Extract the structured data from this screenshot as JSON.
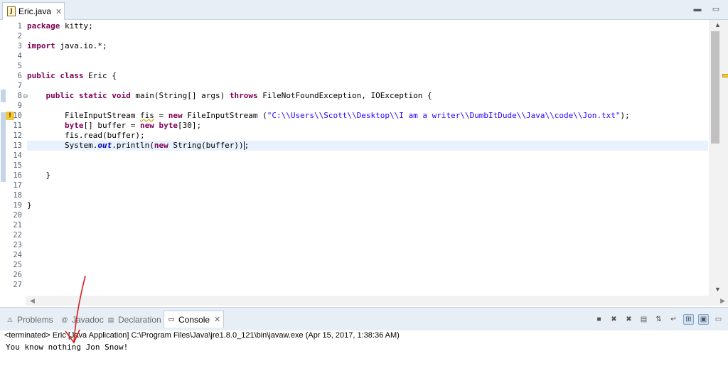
{
  "editor": {
    "tab_label": "Eric.java",
    "tab_icon": "J",
    "lines": [
      {
        "n": "1",
        "segs": [
          {
            "t": "package",
            "c": "kw"
          },
          {
            "t": " kitty;"
          }
        ]
      },
      {
        "n": "2",
        "segs": []
      },
      {
        "n": "3",
        "segs": [
          {
            "t": "import",
            "c": "kw"
          },
          {
            "t": " java.io.*;"
          }
        ]
      },
      {
        "n": "4",
        "segs": []
      },
      {
        "n": "5",
        "segs": []
      },
      {
        "n": "6",
        "segs": [
          {
            "t": "public",
            "c": "kw"
          },
          {
            "t": " "
          },
          {
            "t": "class",
            "c": "kw"
          },
          {
            "t": " Eric {"
          }
        ]
      },
      {
        "n": "7",
        "segs": []
      },
      {
        "n": "8",
        "segs": [
          {
            "t": "    "
          },
          {
            "t": "public",
            "c": "kw"
          },
          {
            "t": " "
          },
          {
            "t": "static",
            "c": "kw"
          },
          {
            "t": " "
          },
          {
            "t": "void",
            "c": "kw"
          },
          {
            "t": " main(String[] args) "
          },
          {
            "t": "throws",
            "c": "kw"
          },
          {
            "t": " FileNotFoundException, IOException {"
          }
        ]
      },
      {
        "n": "9",
        "segs": []
      },
      {
        "n": "10",
        "segs": [
          {
            "t": "        FileInputStream "
          },
          {
            "t": "fis",
            "c": "warnvar"
          },
          {
            "t": " = "
          },
          {
            "t": "new",
            "c": "kw"
          },
          {
            "t": " FileInputStream ("
          },
          {
            "t": "\"C:\\\\Users\\\\Scott\\\\Desktop\\\\I am a writer\\\\DumbItDude\\\\Java\\\\code\\\\Jon.txt\"",
            "c": "str"
          },
          {
            "t": ");"
          }
        ]
      },
      {
        "n": "11",
        "segs": [
          {
            "t": "        "
          },
          {
            "t": "byte",
            "c": "kw"
          },
          {
            "t": "[] buffer = "
          },
          {
            "t": "new",
            "c": "kw"
          },
          {
            "t": " "
          },
          {
            "t": "byte",
            "c": "kw"
          },
          {
            "t": "[30];"
          }
        ]
      },
      {
        "n": "12",
        "segs": [
          {
            "t": "        fis.read(buffer);"
          }
        ]
      },
      {
        "n": "13",
        "segs": [
          {
            "t": "        System."
          },
          {
            "t": "out",
            "c": "fld"
          },
          {
            "t": ".println("
          },
          {
            "t": "new",
            "c": "kw"
          },
          {
            "t": " String(buffer))"
          },
          {
            "t": "",
            "c": "caret"
          },
          {
            "t": ";"
          }
        ]
      },
      {
        "n": "14",
        "segs": []
      },
      {
        "n": "15",
        "segs": []
      },
      {
        "n": "16",
        "segs": [
          {
            "t": "    }"
          }
        ]
      },
      {
        "n": "17",
        "segs": []
      },
      {
        "n": "18",
        "segs": []
      },
      {
        "n": "19",
        "segs": [
          {
            "t": "}"
          }
        ]
      },
      {
        "n": "20",
        "segs": []
      },
      {
        "n": "21",
        "segs": []
      },
      {
        "n": "22",
        "segs": []
      },
      {
        "n": "23",
        "segs": []
      },
      {
        "n": "24",
        "segs": []
      },
      {
        "n": "25",
        "segs": []
      },
      {
        "n": "26",
        "segs": []
      },
      {
        "n": "27",
        "segs": []
      }
    ],
    "current_line": "13",
    "fold_line": "8",
    "warning_line": "10"
  },
  "panel": {
    "tabs": [
      {
        "label": "Problems",
        "icon": "problems-icon",
        "active": false
      },
      {
        "label": "Javadoc",
        "icon": "javadoc-icon",
        "active": false
      },
      {
        "label": "Declaration",
        "icon": "declaration-icon",
        "active": false
      },
      {
        "label": "Console",
        "icon": "console-icon",
        "active": true
      }
    ],
    "toolbar": [
      {
        "icon": "stop-icon",
        "glyph": "■",
        "pressed": false
      },
      {
        "icon": "remove-launch-icon",
        "glyph": "✖",
        "pressed": false
      },
      {
        "icon": "remove-all-terminated-icon",
        "glyph": "✖",
        "pressed": false
      },
      {
        "icon": "clear-console-icon",
        "glyph": "▤",
        "pressed": false
      },
      {
        "icon": "scroll-lock-icon",
        "glyph": "⇅",
        "pressed": false
      },
      {
        "icon": "word-wrap-icon",
        "glyph": "↵",
        "pressed": false
      },
      {
        "icon": "pin-console-icon",
        "glyph": "⊞",
        "pressed": true
      },
      {
        "icon": "display-selected-console-icon",
        "glyph": "▣",
        "pressed": true
      },
      {
        "icon": "open-console-icon",
        "glyph": "▭",
        "pressed": false
      }
    ],
    "status": "<terminated> Eric [Java Application] C:\\Program Files\\Java\\jre1.8.0_121\\bin\\javaw.exe (Apr 15, 2017, 1:38:36 AM)",
    "output": "You know nothing Jon Snow!"
  },
  "colors": {
    "keyword": "#7f0055",
    "string": "#2a00ff",
    "annotation_arrow": "#d42020"
  }
}
